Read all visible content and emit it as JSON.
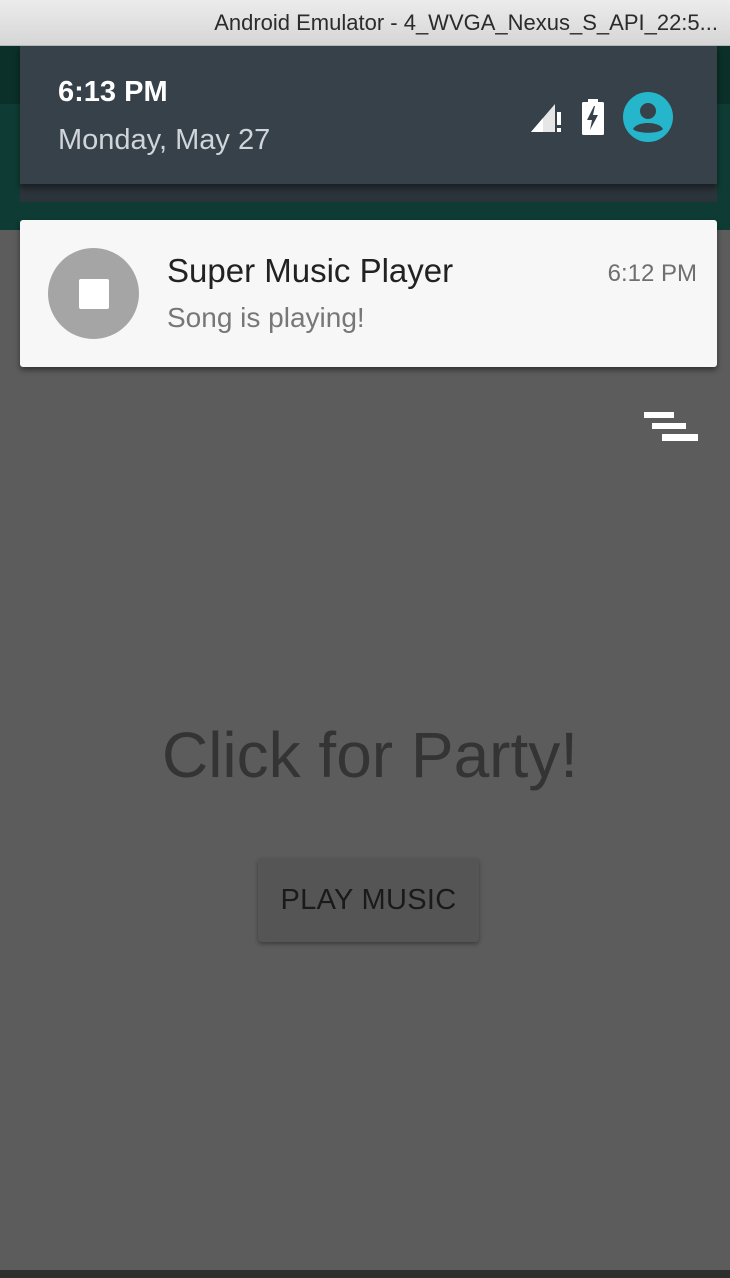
{
  "window": {
    "title": "Android Emulator - 4_WVGA_Nexus_S_API_22:5..."
  },
  "quick_settings": {
    "time": "6:13 PM",
    "date": "Monday, May 27",
    "icons": [
      "signal-no-data-icon",
      "battery-charging-icon",
      "user-account-icon"
    ],
    "accent_color": "#26b6cc"
  },
  "notification": {
    "icon": "stop-icon",
    "title": "Super Music Player",
    "text": "Song is playing!",
    "time": "6:12 PM"
  },
  "shade": {
    "clear_all_icon": "clear-all-icon"
  },
  "app": {
    "headline": "Click for Party!",
    "play_button_label": "PLAY MUSIC"
  }
}
